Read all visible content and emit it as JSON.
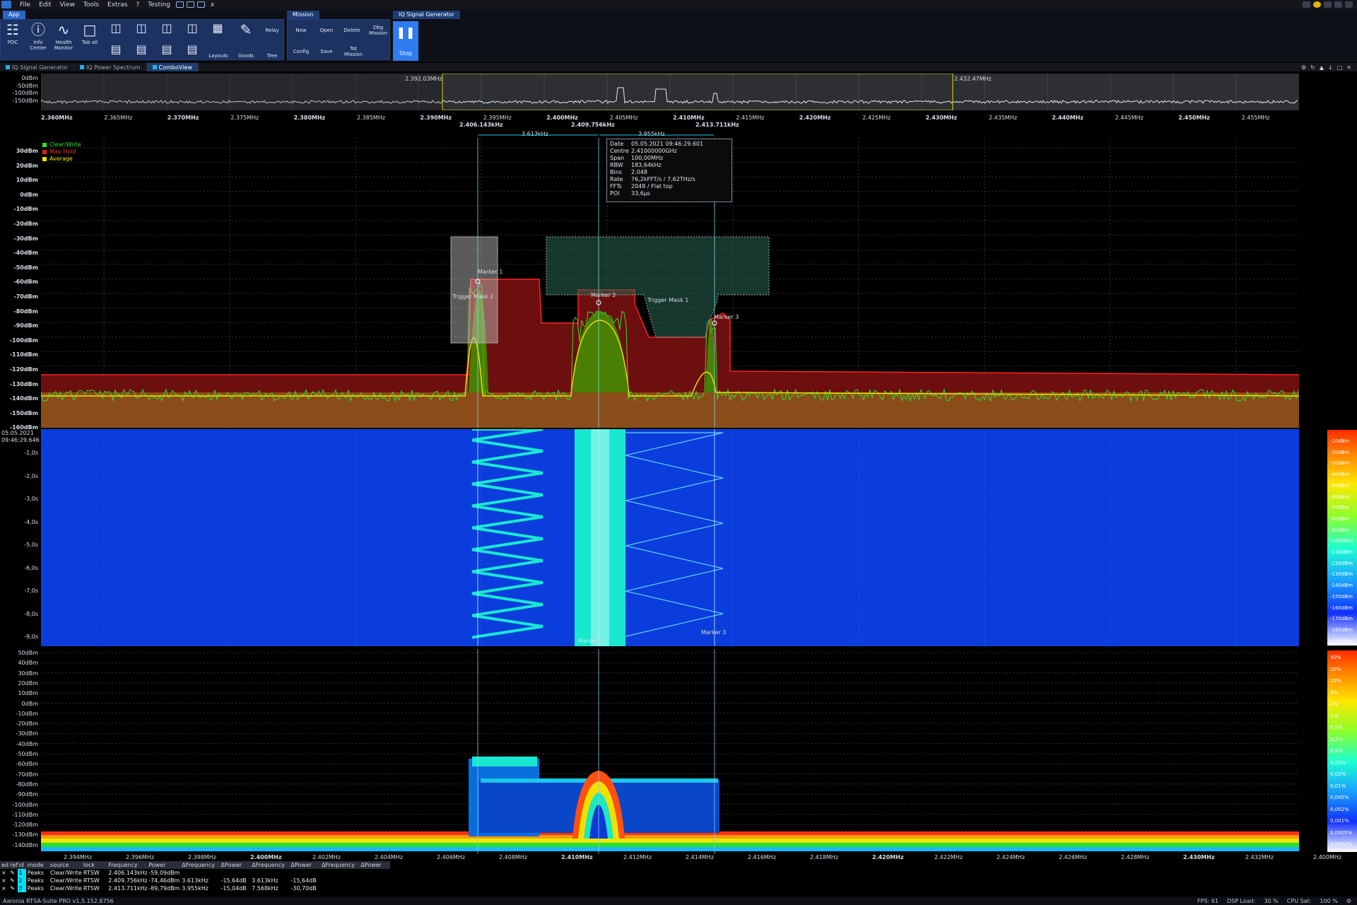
{
  "menu": {
    "items": [
      "File",
      "Edit",
      "View",
      "Tools",
      "Extras",
      "?",
      "Testing"
    ],
    "close": "x"
  },
  "ribbon": {
    "tabs": {
      "app": "App",
      "mission": "Mission",
      "iqgen": "IQ Signal Generator"
    },
    "buttons": {
      "poc": "POC",
      "info": "Info Center",
      "health": "Health Monitor",
      "taball": "Tab all",
      "layouts": "Layouts",
      "goods": "Goods",
      "relay": "Relay",
      "tree": "Tree",
      "new": "New",
      "open": "Open",
      "delete": "Delete",
      "dbg": "Dbg Mission",
      "config": "Config",
      "save": "Save",
      "tot": "Tot Mission",
      "stop": "Stop"
    }
  },
  "doc_tabs": [
    {
      "label": "IQ Signal Generator"
    },
    {
      "label": "IQ Power Spectrum"
    },
    {
      "label": "ComboView"
    }
  ],
  "overview": {
    "y_ticks": [
      "0dBm",
      "-50dBm",
      "-100dBm",
      "-150dBm"
    ],
    "x_ticks": [
      "2.360MHz",
      "2.365MHz",
      "2.370MHz",
      "2.375MHz",
      "2.380MHz",
      "2.385MHz",
      "2.390MHz",
      "2.395MHz",
      "2.400MHz",
      "2.405MHz",
      "2.410MHz",
      "2.415MHz",
      "2.420MHz",
      "2.425MHz",
      "2.430MHz",
      "2.435MHz",
      "2.440MHz",
      "2.445MHz",
      "2.450MHz",
      "2.455MHz"
    ],
    "sel_left": "2.392.03MHz",
    "sel_right": "2.432.47MHz"
  },
  "spectrum": {
    "y_ticks": [
      "30dBm",
      "20dBm",
      "10dBm",
      "0dBm",
      "-10dBm",
      "-20dBm",
      "-30dBm",
      "-40dBm",
      "-50dBm",
      "-60dBm",
      "-70dBm",
      "-80dBm",
      "-90dBm",
      "-100dBm",
      "-110dBm",
      "-120dBm",
      "-130dBm",
      "-140dBm",
      "-150dBm",
      "-160dBm"
    ],
    "legend": [
      "Clear/Write",
      "Max Hold",
      "Average"
    ],
    "marker_freqs": [
      "2.406.143kHz",
      "2.409.756kHz",
      "2.413.711kHz"
    ],
    "deltas": [
      "3.613kHz",
      "3.955kHz"
    ],
    "labels": {
      "m1": "Marker 1",
      "m2": "Marker 2",
      "m3": "Marker 3",
      "tm1": "Trigger Mask 1",
      "tm2": "Trigger Mask 2"
    },
    "info": [
      [
        "Date",
        "05.05.2021 09:46:29.601"
      ],
      [
        "Centre",
        "2.41000000GHz"
      ],
      [
        "Span",
        "100,00MHz"
      ],
      [
        "RBW",
        "183,64kHz"
      ],
      [
        "Bins",
        "2.048"
      ],
      [
        "Rate",
        "76,2kFFT/s / 7,62THz/s"
      ],
      [
        "FFTs",
        "2048 / Flat top"
      ],
      [
        "POI",
        "33,6μs"
      ]
    ]
  },
  "waterfall": {
    "date": "05.05.2021",
    "time": "09:46:29.646",
    "y_ticks": [
      "-1,0s",
      "-2,0s",
      "-3,0s",
      "-4,0s",
      "-5,0s",
      "-6,0s",
      "-7,0s",
      "-8,0s",
      "-9,0s"
    ],
    "colorbar": [
      "-10dBm",
      "-20dBm",
      "-30dBm",
      "-40dBm",
      "-50dBm",
      "-60dBm",
      "-70dBm",
      "-80dBm",
      "-90dBm",
      "-100dBm",
      "-110dBm",
      "-120dBm",
      "-130dBm",
      "-140dBm",
      "-150dBm",
      "-160dBm",
      "-170dBm",
      "-180dBm",
      "-190dBm"
    ],
    "m2": "Marker 2",
    "m3": "Marker 3"
  },
  "persistence": {
    "y_ticks": [
      "50dBm",
      "40dBm",
      "30dBm",
      "20dBm",
      "10dBm",
      "0dBm",
      "-10dBm",
      "-20dBm",
      "-30dBm",
      "-40dBm",
      "-50dBm",
      "-60dBm",
      "-70dBm",
      "-80dBm",
      "-90dBm",
      "-100dBm",
      "-110dBm",
      "-120dBm",
      "-130dBm",
      "-140dBm"
    ],
    "x_ticks": [
      "2.394MHz",
      "2.396MHz",
      "2.398MHz",
      "2.400MHz",
      "2.402MHz",
      "2.404MHz",
      "2.406MHz",
      "2.408MHz",
      "2.410MHz",
      "2.412MHz",
      "2.414MHz",
      "2.416MHz",
      "2.418MHz",
      "2.420MHz",
      "2.422MHz",
      "2.424MHz",
      "2.426MHz",
      "2.428MHz",
      "2.430MHz",
      "2.432MHz"
    ],
    "x_end": "2.400MHz",
    "colorbar": [
      "50%",
      "20%",
      "10%",
      "5%",
      "2%",
      "1%",
      "0,5%",
      "0,2%",
      "0,1%",
      "0,05%",
      "0,02%",
      "0,01%",
      "0,005%",
      "0,002%",
      "0,001%",
      "0,0005%",
      "0,0002%"
    ]
  },
  "marker_table": {
    "headers": [
      "edit",
      "ref",
      "id",
      "mode",
      "source",
      "lock",
      "Frequency",
      "Power",
      "ΔFrequency",
      "ΔPower",
      "ΔFrequency",
      "ΔPower",
      "ΔFrequency",
      "ΔPower"
    ],
    "rows": [
      [
        "1",
        "Peaks",
        "Clear/Write",
        "RTSW",
        "2.406.143kHz",
        "-59,09dBm",
        "",
        "",
        "",
        "",
        "",
        ""
      ],
      [
        "2",
        "Peaks",
        "Clear/Write",
        "RTSW",
        "2.409.756kHz",
        "-74,46dBm",
        "3.613kHz",
        "-15,64dB",
        "3.613kHz",
        "-15,64dB",
        "",
        ""
      ],
      [
        "3",
        "Peaks",
        "Clear/Write",
        "RTSW",
        "2.413.711kHz",
        "-89,79dBm",
        "3.955kHz",
        "-15,04dB",
        "7.568kHz",
        "-30,70dB",
        "",
        ""
      ]
    ]
  },
  "status": {
    "app": "Aaronia RTSA-Suite PRO v1.5.152.8756",
    "fps": "FPS: 61",
    "dsp": "DSP Load:",
    "dsp_val": "30 %",
    "cpu": "CPU Sat:",
    "cpu_val": "100 %"
  }
}
